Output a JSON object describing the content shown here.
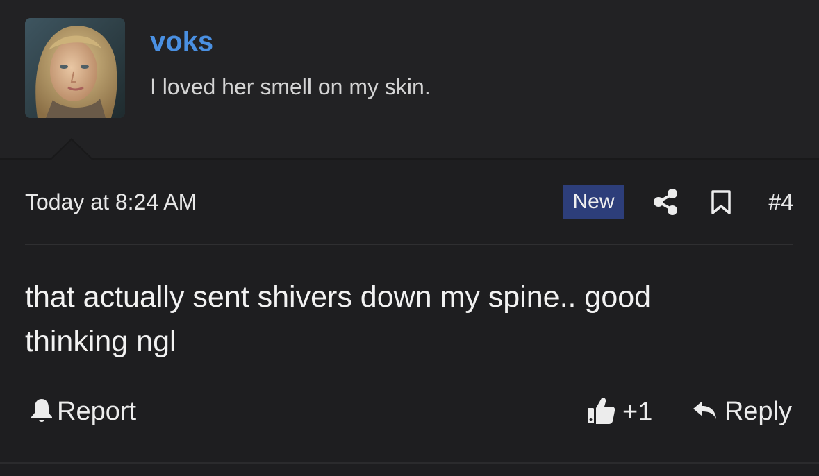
{
  "author": {
    "username": "voks",
    "title": "I loved her smell on my skin.",
    "avatar_icon": "user-avatar-photo"
  },
  "post": {
    "timestamp": "Today at 8:24 AM",
    "badge": "New",
    "number": "#4",
    "body": "that actually sent shivers down my spine.. good thinking ngl"
  },
  "actions": {
    "report_label": "Report",
    "like_count": "+1",
    "reply_label": "Reply"
  },
  "colors": {
    "username": "#4a90e2",
    "badge_bg": "#2d3e7a",
    "background": "#1e1e20",
    "header_bg": "#222224"
  },
  "icons": {
    "share": "share-icon",
    "bookmark": "bookmark-icon",
    "report": "bell-icon",
    "like": "thumbs-up-icon",
    "reply": "reply-arrow-icon"
  }
}
